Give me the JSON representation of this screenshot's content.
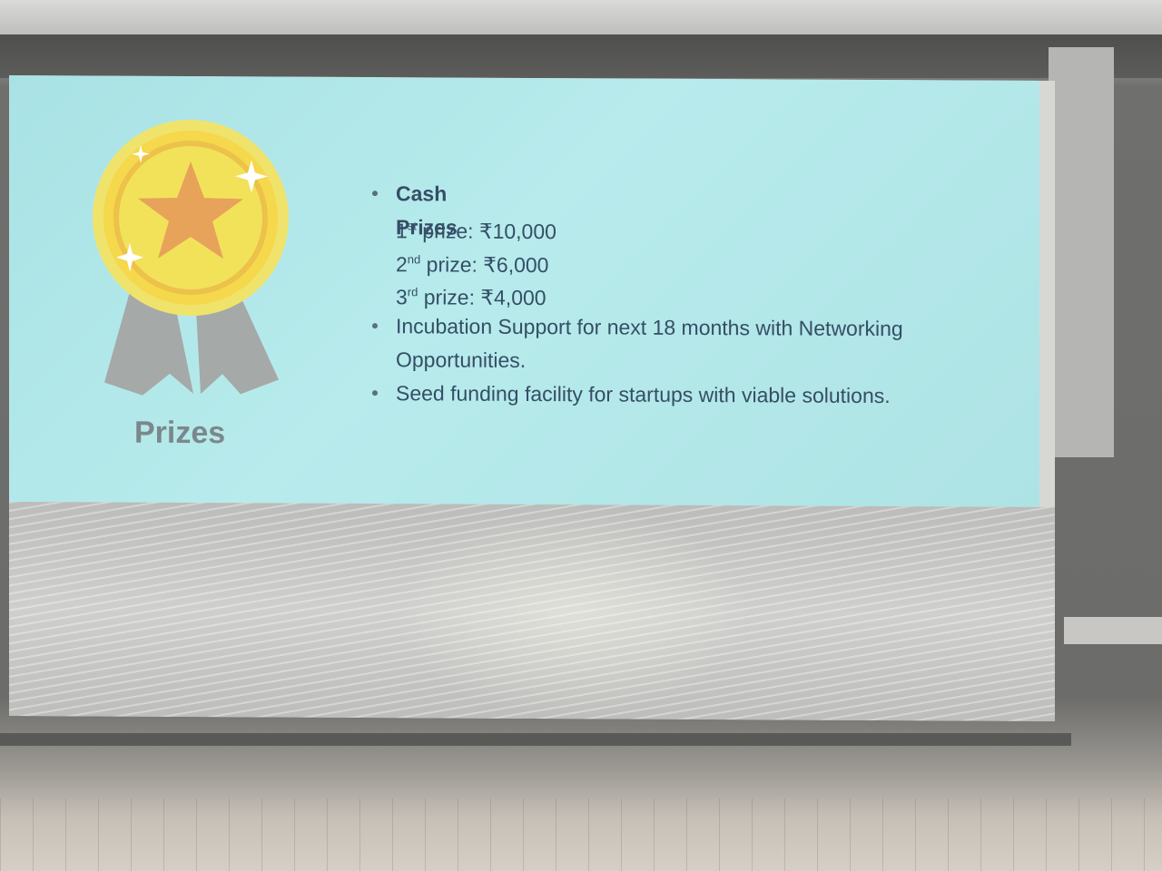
{
  "slide": {
    "heading": "Prizes",
    "cash": {
      "title": "Cash Prizes",
      "items": [
        {
          "ord_num": "1",
          "ord_sup": "st",
          "label": " prize: ₹10,000"
        },
        {
          "ord_num": "2",
          "ord_sup": "nd",
          "label": " prize: ₹6,000"
        },
        {
          "ord_num": "3",
          "ord_sup": "rd",
          "label": " prize: ₹4,000"
        }
      ]
    },
    "incubation_line1": "Incubation Support for next 18 months with Networking",
    "incubation_line2": "Opportunities.",
    "seed": "Seed funding facility for startups with viable solutions."
  },
  "icons": {
    "medal": "award-medal-icon",
    "star": "star-icon",
    "sparkle": "sparkle-icon"
  },
  "colors": {
    "slide_bg": "#b7ebec",
    "text": "#354e66",
    "heading": "#7c878c",
    "medal_yellow": "#f2e25a",
    "star_orange": "#e7a35a",
    "ribbon_gray": "#a5a9a8"
  }
}
